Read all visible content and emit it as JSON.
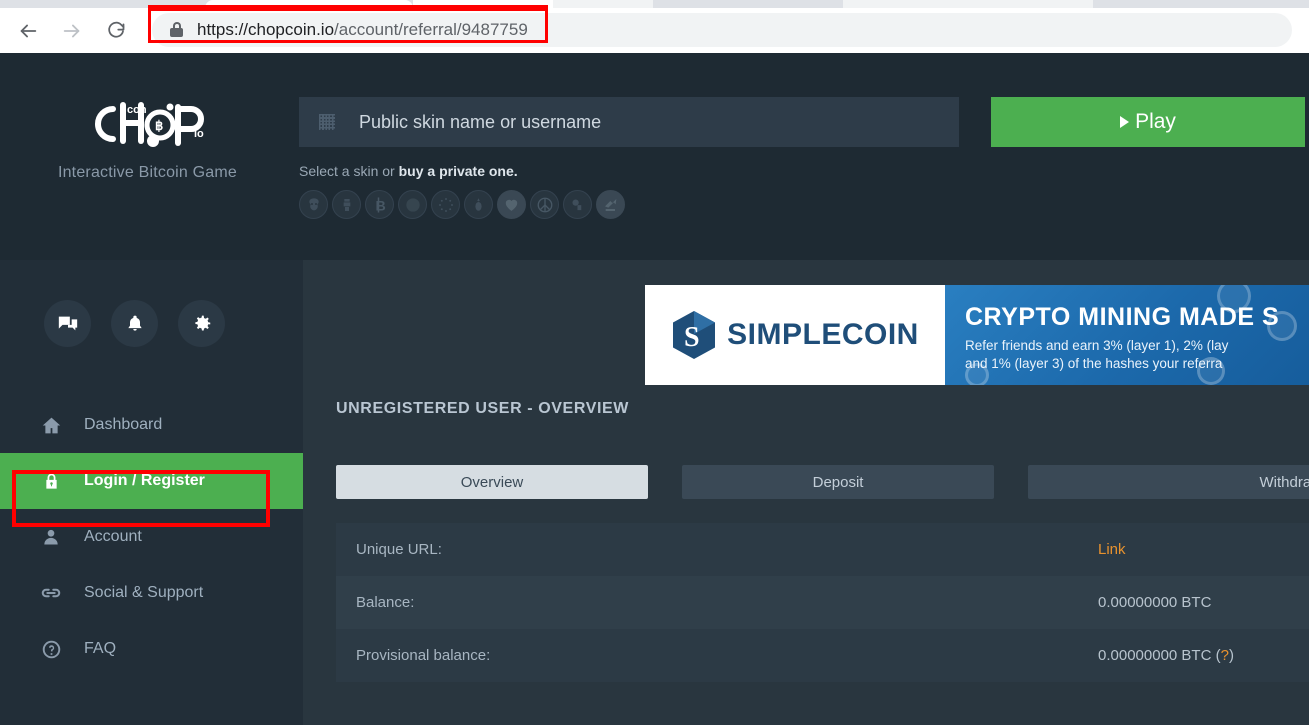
{
  "browser": {
    "back_icon": "back-arrow-icon",
    "forward_icon": "forward-arrow-icon",
    "reload_icon": "reload-icon",
    "lock_icon": "lock-icon",
    "url_domain": "https://chopcoin.io",
    "url_path": "/account/referral/9487759",
    "annotation_color": "#ff0000"
  },
  "header": {
    "logo_text": "chopcoin.io",
    "tagline": "Interactive Bitcoin Game",
    "skin_input": {
      "icon": "grid-icon",
      "placeholder": "Public skin name or username",
      "value": ""
    },
    "skin_hint_prefix": "Select a skin or ",
    "skin_hint_link": "buy a private one.",
    "skins": [
      {
        "name": "anonymous-mask-skin",
        "glyph": "☠"
      },
      {
        "name": "doge-skin",
        "glyph": "♟"
      },
      {
        "name": "bitcoin-skin",
        "glyph": "Ƀ"
      },
      {
        "name": "cannabis-skin",
        "glyph": "⚘"
      },
      {
        "name": "eu-flag-skin",
        "glyph": "✳"
      },
      {
        "name": "pineapple-skin",
        "glyph": "⸙"
      },
      {
        "name": "heart-skin",
        "glyph": "♥"
      },
      {
        "name": "peace-skin",
        "glyph": "☮"
      },
      {
        "name": "sheep-skin",
        "glyph": "♏"
      },
      {
        "name": "unicorn-skin",
        "glyph": "➤"
      }
    ],
    "play_label": "Play",
    "play_color": "#4caf50"
  },
  "sidebar": {
    "tools": [
      {
        "name": "chat-icon",
        "label": "Chat"
      },
      {
        "name": "notifications-bell-icon",
        "label": "Notifications"
      },
      {
        "name": "settings-gear-icon",
        "label": "Settings"
      }
    ],
    "items": [
      {
        "label": "Dashboard",
        "icon": "home-icon",
        "active": false
      },
      {
        "label": "Login / Register",
        "icon": "lock-icon",
        "active": true
      },
      {
        "label": "Account",
        "icon": "person-icon",
        "active": false
      },
      {
        "label": "Social & Support",
        "icon": "link-icon",
        "active": false
      },
      {
        "label": "FAQ",
        "icon": "question-circle-icon",
        "active": false
      }
    ],
    "active_color": "#4caf50"
  },
  "banner": {
    "brand": "SIMPLECOIN",
    "brand_color": "#1f4e79",
    "headline": "CRYPTO MINING MADE S",
    "subline_1": "Refer friends and earn 3% (layer 1), 2% (lay",
    "subline_2": "and 1% (layer 3) of the hashes your referra"
  },
  "main": {
    "page_title": "UNREGISTERED USER - OVERVIEW",
    "tabs": [
      {
        "label": "Overview",
        "active": true
      },
      {
        "label": "Deposit",
        "active": false
      },
      {
        "label": "Withdraw",
        "active": false
      }
    ],
    "rows": [
      {
        "label": "Unique URL:",
        "value": "Link",
        "value_type": "link"
      },
      {
        "label": "Balance:",
        "value": "0.00000000 BTC",
        "value_type": "text"
      },
      {
        "label": "Provisional balance:",
        "value": "0.00000000 BTC",
        "value_type": "text-with-help",
        "help": "?"
      }
    ],
    "link_color": "#e8922e"
  }
}
